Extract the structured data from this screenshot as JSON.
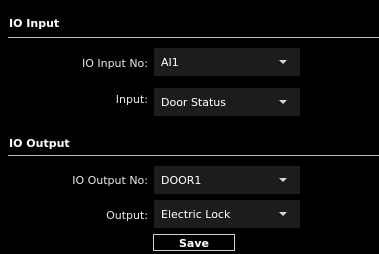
{
  "io_input": {
    "section_title": "IO Input",
    "input_no_label": "IO Input No:",
    "input_no_value": "AI1",
    "input_label": "Input:",
    "input_value": "Door Status"
  },
  "io_output": {
    "section_title": "IO Output",
    "output_no_label": "IO Output No:",
    "output_no_value": "DOOR1",
    "output_label": "Output:",
    "output_value": "Electric Lock"
  },
  "actions": {
    "save_label": "Save"
  },
  "colors": {
    "background": "#000000",
    "divider": "#bdbdbd",
    "select_bg": "#1c1c1c",
    "text": "#ffffff"
  },
  "icons": {
    "dropdown": "chevron-down-icon"
  }
}
